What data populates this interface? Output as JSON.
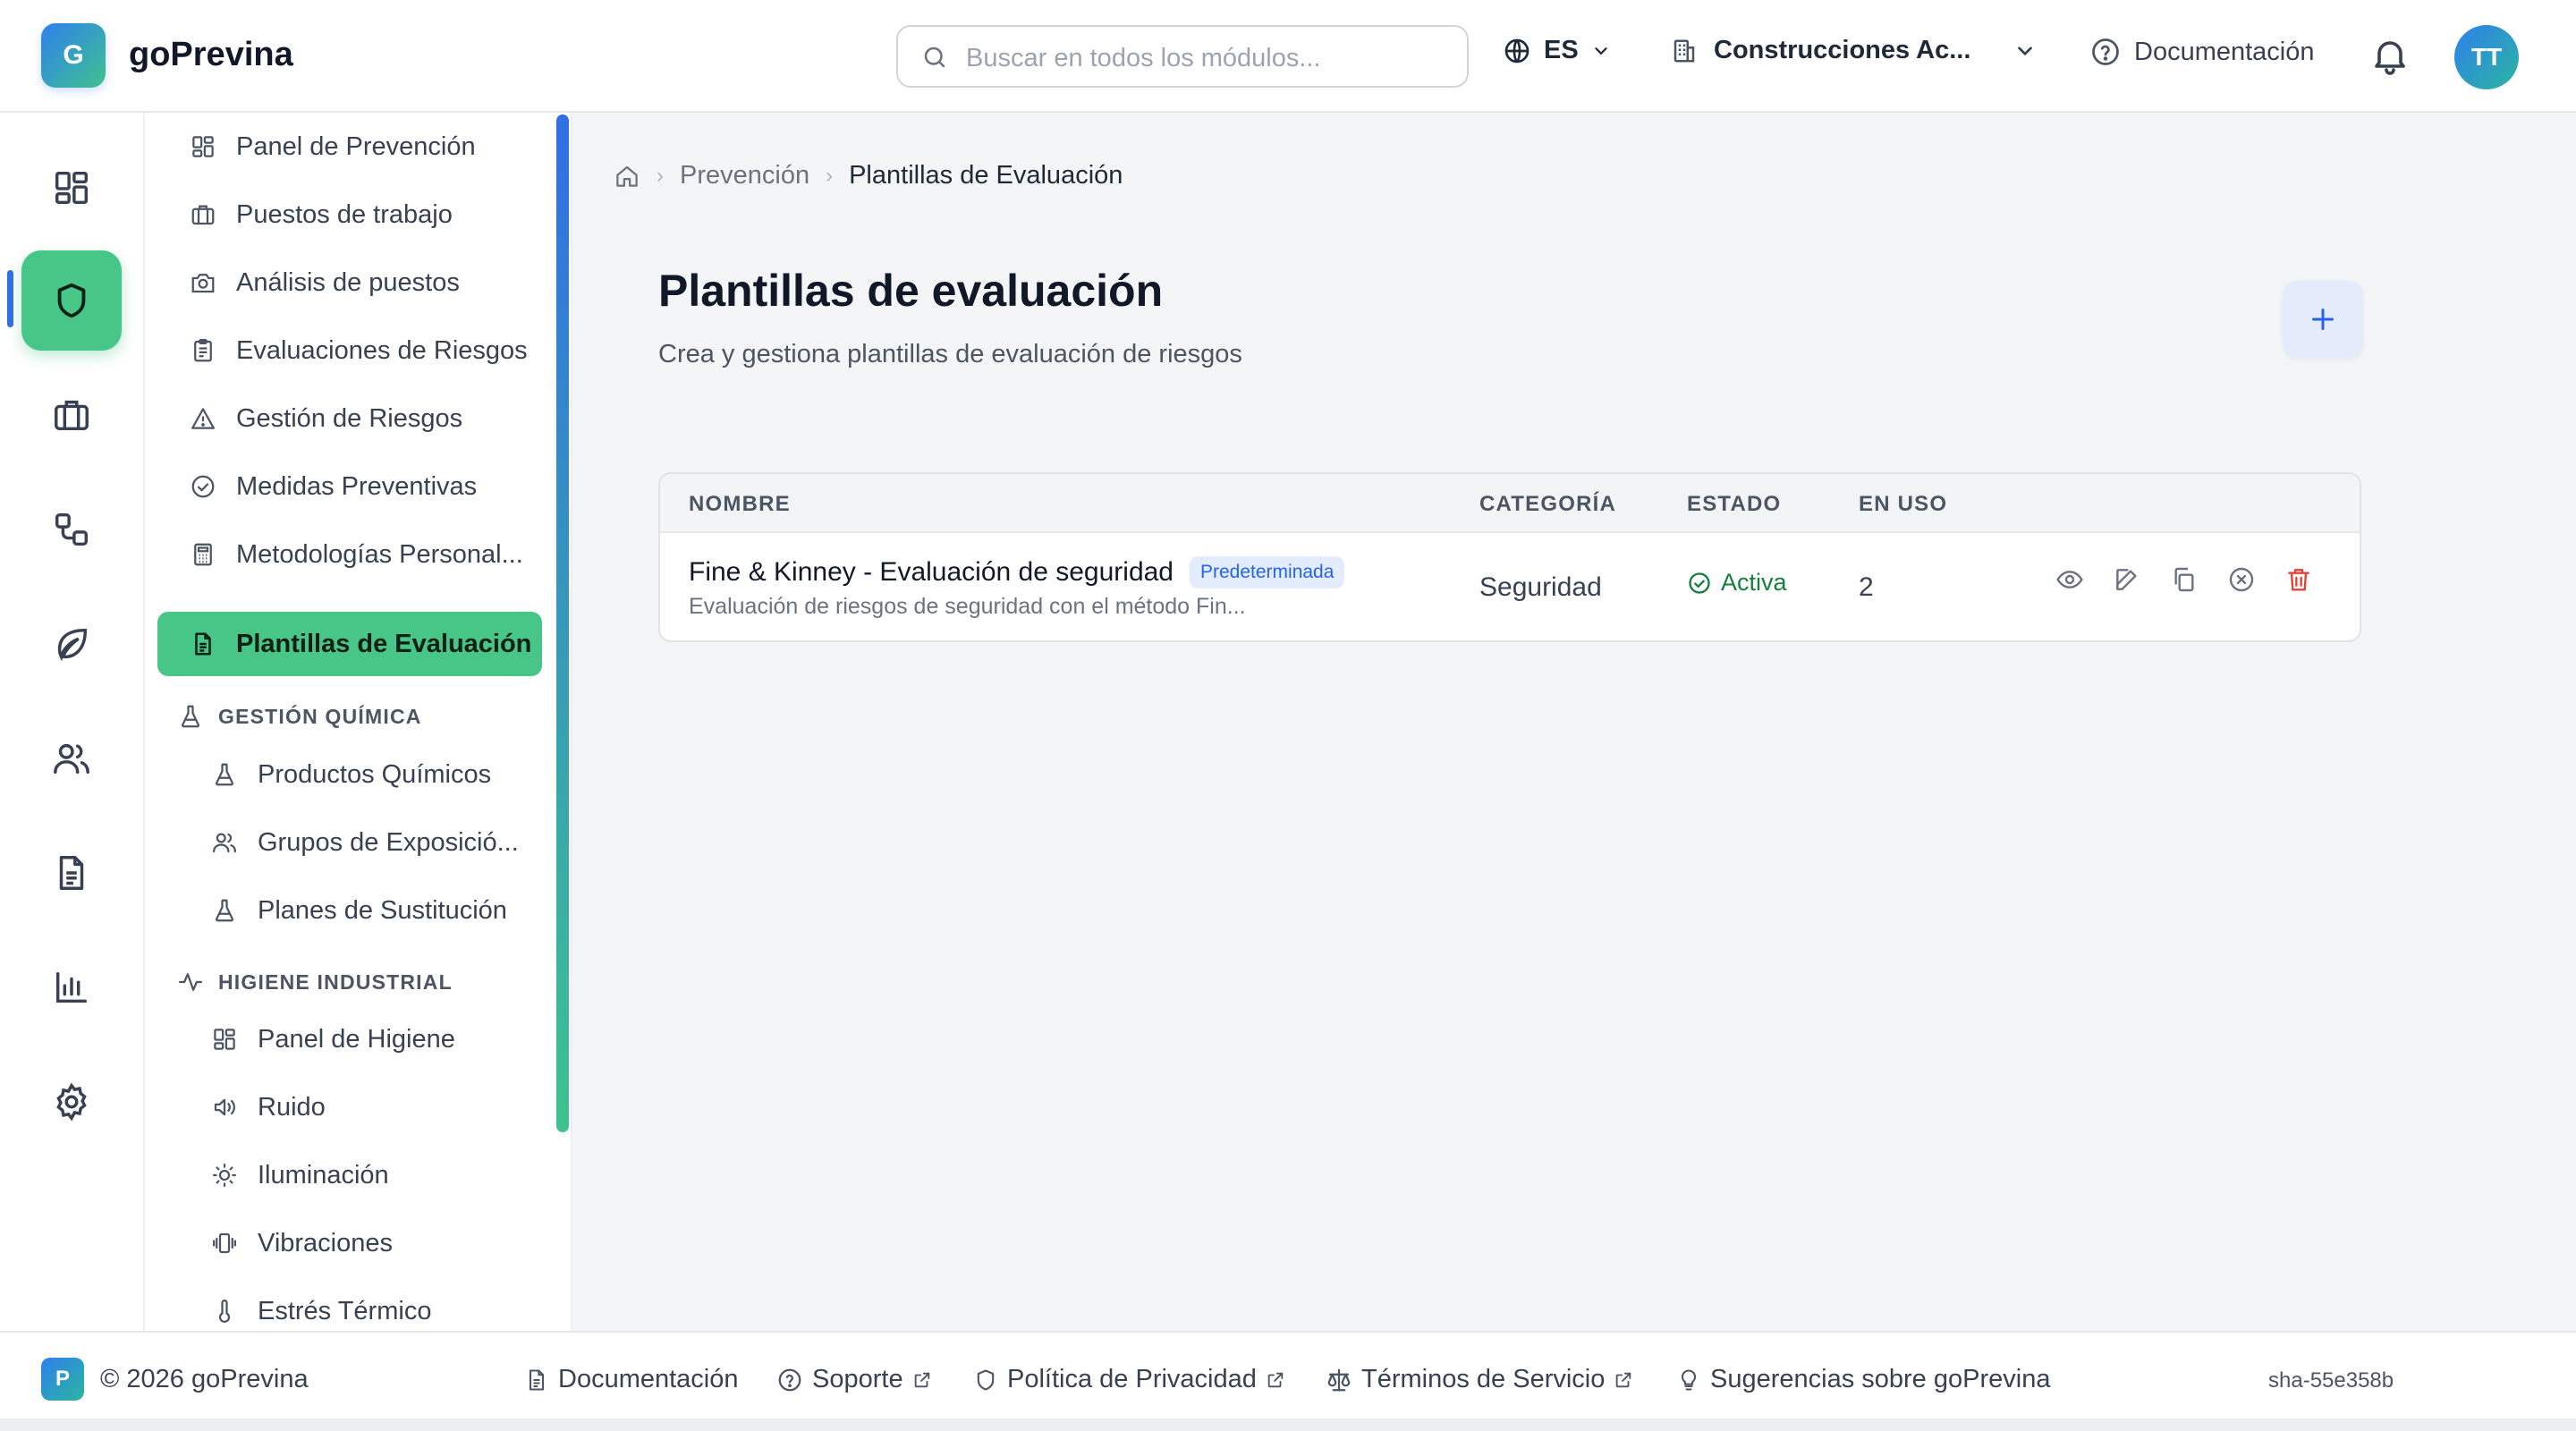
{
  "app": {
    "logo_letter": "G",
    "name": "goPrevina"
  },
  "header": {
    "search_placeholder": "Buscar en todos los módulos...",
    "language": "ES",
    "company": "Construcciones Ac...",
    "docs_label": "Documentación",
    "avatar_initials": "TT"
  },
  "rail": {
    "items": [
      "dashboard-icon",
      "shield-icon",
      "briefcase-icon",
      "workflow-icon",
      "leaf-icon",
      "users-icon",
      "document-icon",
      "bar-chart-icon",
      "gear-icon"
    ],
    "active_index": 1
  },
  "sidebar": {
    "items": [
      {
        "label": "Panel de Prevención",
        "icon": "dashboard-icon"
      },
      {
        "label": "Puestos de trabajo",
        "icon": "briefcase-icon"
      },
      {
        "label": "Análisis de puestos",
        "icon": "camera-icon"
      },
      {
        "label": "Evaluaciones de Riesgos",
        "icon": "clipboard-icon"
      },
      {
        "label": "Gestión de Riesgos",
        "icon": "warning-icon"
      },
      {
        "label": "Medidas Preventivas",
        "icon": "check-circle-icon"
      },
      {
        "label": "Metodologías Personal...",
        "icon": "calculator-icon"
      },
      {
        "label": "Plantillas de Evaluación",
        "icon": "document-icon"
      }
    ],
    "active_item": "Plantillas de Evaluación",
    "sections": [
      {
        "title": "GESTIÓN QUÍMICA",
        "items": [
          "Productos Químicos",
          "Grupos de Exposició...",
          "Planes de Sustitución"
        ]
      },
      {
        "title": "HIGIENE INDUSTRIAL",
        "items": [
          "Panel de Higiene",
          "Ruido",
          "Iluminación",
          "Vibraciones",
          "Estrés Térmico"
        ]
      }
    ]
  },
  "breadcrumb": {
    "parent": "Prevención",
    "current": "Plantillas de Evaluación"
  },
  "page": {
    "title": "Plantillas de evaluación",
    "subtitle": "Crea y gestiona plantillas de evaluación de riesgos"
  },
  "table": {
    "columns": [
      "NOMBRE",
      "CATEGORÍA",
      "ESTADO",
      "EN USO"
    ],
    "rows": [
      {
        "name": "Fine & Kinney - Evaluación de seguridad",
        "badge": "Predeterminada",
        "description": "Evaluación de riesgos de seguridad con el método Fin...",
        "category": "Seguridad",
        "status": "Activa",
        "in_use": "2"
      }
    ]
  },
  "footer": {
    "logo_letter": "P",
    "copyright": "© 2026 goPrevina",
    "links": [
      "Documentación",
      "Soporte",
      "Política de Privacidad",
      "Términos de Servicio",
      "Sugerencias sobre goPrevina"
    ],
    "build": "sha-55e358b"
  },
  "colors": {
    "accent_green": "#47c687",
    "accent_blue": "#2f6fe4",
    "danger": "#e0433a",
    "success": "#15803d"
  }
}
